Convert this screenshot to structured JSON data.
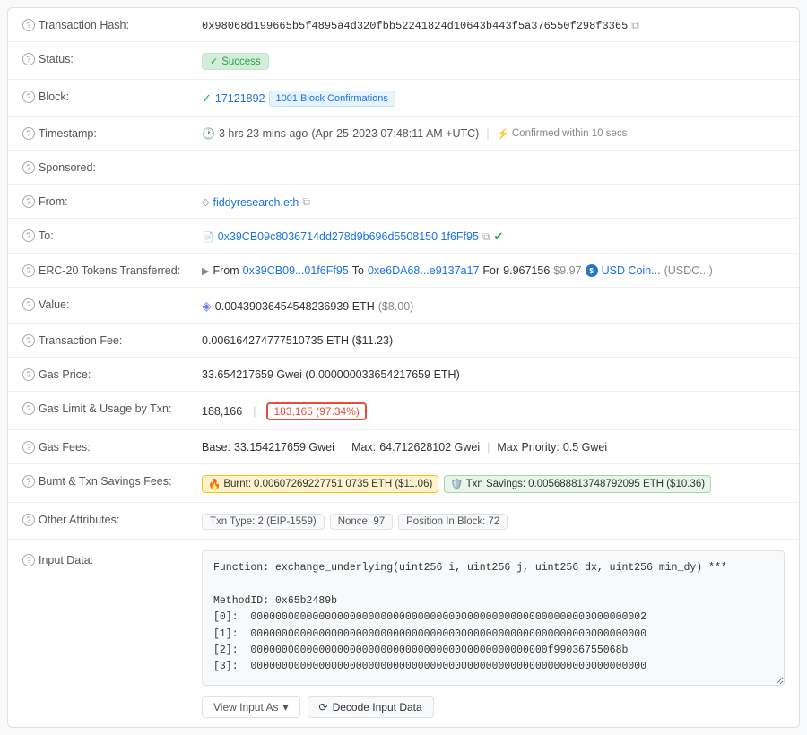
{
  "transaction": {
    "hash": {
      "label": "Transaction Hash:",
      "value": "0x98068d199665b5f4895a4d320fbb52241824d10643b443f5a376550f298f3365"
    },
    "status": {
      "label": "Status:",
      "value": "Success"
    },
    "block": {
      "label": "Block:",
      "number": "17121892",
      "confirmations": "1001 Block Confirmations"
    },
    "timestamp": {
      "label": "Timestamp:",
      "ago": "3 hrs 23 mins ago",
      "date": "(Apr-25-2023 07:48:11 AM +UTC)",
      "confirmed": "Confirmed within 10 secs"
    },
    "sponsored": {
      "label": "Sponsored:"
    },
    "from": {
      "label": "From:",
      "value": "fiddyresearch.eth"
    },
    "to": {
      "label": "To:",
      "value": "0x39CB09c8036714dd278d9b696d5508150 1f6Ff95"
    },
    "erc20": {
      "label": "ERC-20 Tokens Transferred:",
      "from_addr": "0x39CB09...01f6Ff95",
      "to_addr": "0xe6DA68...e9137a17",
      "amount": "9.967156",
      "usd": "$9.97",
      "token": "USD Coin...",
      "token_abbr": "(USDC...)"
    },
    "value": {
      "label": "Value:",
      "eth": "0.00439036454548236939 ETH",
      "usd": "($8.00)"
    },
    "tx_fee": {
      "label": "Transaction Fee:",
      "value": "0.006164274777510735 ETH ($11.23)"
    },
    "gas_price": {
      "label": "Gas Price:",
      "value": "33.654217659 Gwei (0.000000033654217659 ETH)"
    },
    "gas_limit": {
      "label": "Gas Limit & Usage by Txn:",
      "limit": "188,166",
      "used": "183,165",
      "pct": "97.34%"
    },
    "gas_fees": {
      "label": "Gas Fees:",
      "base": "33.154217659 Gwei",
      "max": "64.712628102 Gwei",
      "max_priority": "0.5 Gwei"
    },
    "burnt_savings": {
      "label": "Burnt & Txn Savings Fees:",
      "burnt_label": "Burnt:",
      "burnt_value": "0.00607269227751 0735 ETH ($11.06)",
      "savings_label": "Txn Savings:",
      "savings_value": "0.005688813748792095 ETH ($10.36)"
    },
    "other_attrs": {
      "label": "Other Attributes:",
      "txn_type": "Txn Type: 2 (EIP-1559)",
      "nonce": "Nonce: 97",
      "position": "Position In Block: 72"
    },
    "input_data": {
      "label": "Input Data:",
      "content": "Function: exchange_underlying(uint256 i, uint256 j, uint256 dx, uint256 min_dy) ***\n\nMethodID: 0x65b2489b\n[0]:  0000000000000000000000000000000000000000000000000000000000000002\n[1]:  0000000000000000000000000000000000000000000000000000000000000000\n[2]:  000000000000000000000000000000000000000000000000f99036755068b\n[3]:  0000000000000000000000000000000000000000000000000000000000000000",
      "btn_view": "View Input As",
      "btn_decode": "Decode Input Data"
    }
  }
}
